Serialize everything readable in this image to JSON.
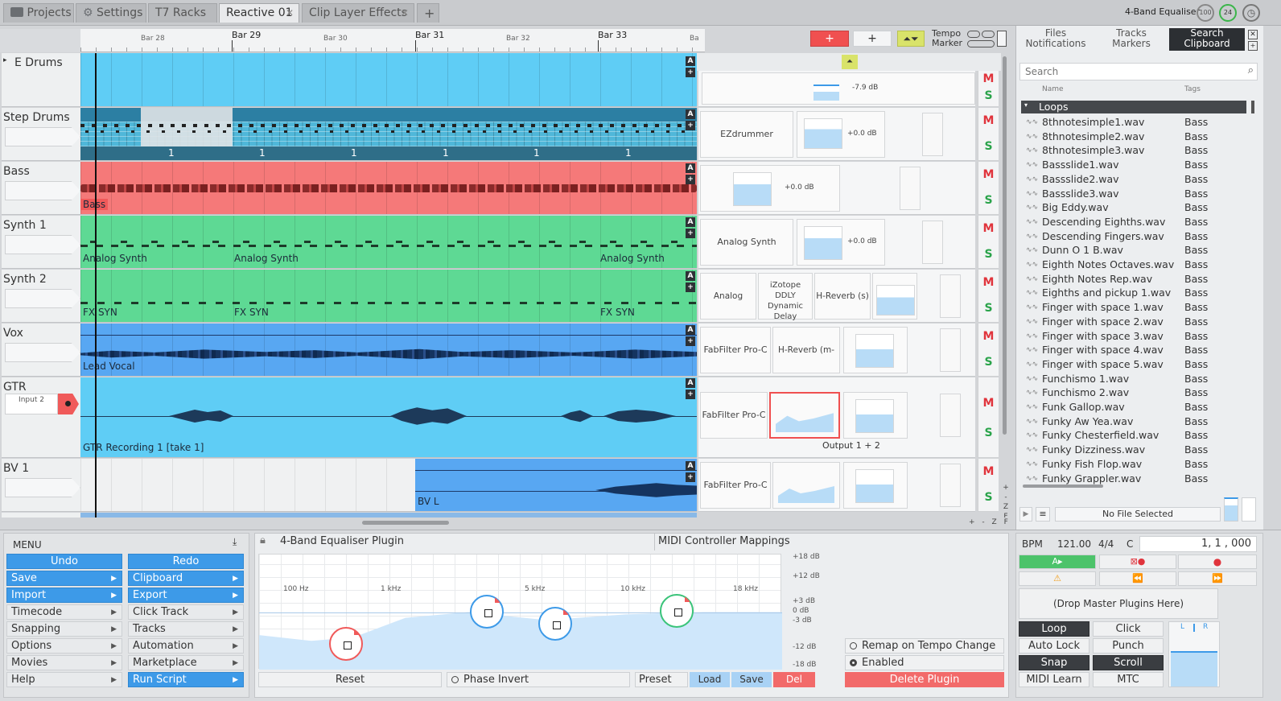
{
  "tabs": [
    {
      "label": "Projects",
      "icon": "folder-icon"
    },
    {
      "label": "Settings",
      "icon": "gear-icon"
    },
    {
      "label": "T7 Racks"
    },
    {
      "label": "Reactive 01",
      "active": true
    },
    {
      "label": "Clip Layer Effects"
    }
  ],
  "header": {
    "plugin_title": "4-Band Equaliser",
    "cpu": "100",
    "gauge": "24"
  },
  "ruler": {
    "bars": [
      "Bar 28",
      "Bar 29",
      "Bar 30",
      "Bar 31",
      "Bar 32",
      "Bar 33",
      "Ba"
    ]
  },
  "transport_top": {
    "tempo": "Tempo",
    "marker": "Marker",
    "add_plus": "+"
  },
  "tracks": [
    {
      "name": "E Drums",
      "db": "-7.9 dB"
    },
    {
      "name": "Step Drums",
      "plugin": "EZdrummer",
      "db": "+0.0 dB",
      "steps": [
        "1",
        "1",
        "1",
        "1",
        "1",
        "1"
      ]
    },
    {
      "name": "Bass",
      "clip": "Bass",
      "db": "+0.0 dB"
    },
    {
      "name": "Synth 1",
      "clip": "Analog Synth",
      "plugin": "Analog Synth",
      "db": "+0.0 dB"
    },
    {
      "name": "Synth 2",
      "clip": "FX SYN",
      "plugins": [
        "Analog Synth",
        "iZotope DDLY Dynamic Delay",
        "H-Reverb (s)"
      ]
    },
    {
      "name": "Vox",
      "clip": "Lead Vocal",
      "plugins": [
        "FabFilter Pro-C",
        "H-Reverb (m->s)"
      ]
    },
    {
      "name": "GTR",
      "input": "Input 2",
      "clip": "GTR Recording 1 [take 1]",
      "plugin": "FabFilter Pro-C",
      "output": "Output 1 + 2"
    },
    {
      "name": "BV 1",
      "clip": "BV L",
      "plugin": "FabFilter Pro-C"
    }
  ],
  "labels": {
    "m": "M",
    "s": "S",
    "a": "A",
    "plus": "+"
  },
  "browser": {
    "tabs": [
      {
        "top": "Files",
        "bottom": "Notifications"
      },
      {
        "top": "Tracks",
        "bottom": "Markers"
      },
      {
        "top": "Search",
        "bottom": "Clipboard",
        "active": true
      }
    ],
    "search_placeholder": "Search",
    "col_name": "Name",
    "col_tags": "Tags",
    "folder": "Loops",
    "files": [
      "8thnotesimple1.wav",
      "8thnotesimple2.wav",
      "8thnotesimple3.wav",
      "Bassslide1.wav",
      "Bassslide2.wav",
      "Bassslide3.wav",
      "Big Eddy.wav",
      "Descending Eighths.wav",
      "Descending Fingers.wav",
      "Dunn O 1 B.wav",
      "Eighth Notes Octaves.wav",
      "Eighth Notes Rep.wav",
      "Eighths and pickup 1.wav",
      "Finger with space 1.wav",
      "Finger with space 2.wav",
      "Finger with space 3.wav",
      "Finger with space 4.wav",
      "Finger with space 5.wav",
      "Funchismo 1.wav",
      "Funchismo 2.wav",
      "Funk Gallop.wav",
      "Funky Aw Yea.wav",
      "Funky Chesterfield.wav",
      "Funky Dizziness.wav",
      "Funky Fish Flop.wav",
      "Funky Grappler.wav"
    ],
    "tag": "Bass",
    "no_file": "No File Selected"
  },
  "menu": {
    "title": "MENU",
    "undo": "Undo",
    "redo": "Redo",
    "left": [
      "Save",
      "Import",
      "Timecode",
      "Snapping",
      "Options",
      "Movies",
      "Help"
    ],
    "right": [
      "Clipboard",
      "Export",
      "Click Track",
      "Tracks",
      "Automation",
      "Marketplace",
      "Run Script"
    ]
  },
  "eq": {
    "title": "4-Band Equaliser Plugin",
    "midi": "MIDI Controller Mappings",
    "freqs": [
      "100 Hz",
      "1 kHz",
      "5 kHz",
      "10 kHz",
      "18 kHz"
    ],
    "db": [
      "+18 dB",
      "+12 dB",
      "+3 dB",
      "0 dB",
      "-3 dB",
      "-12 dB",
      "-18 dB"
    ],
    "reset": "Reset",
    "phase": "Phase Invert",
    "preset": "Preset",
    "load": "Load",
    "save": "Save",
    "del": "Del",
    "remap": "Remap on Tempo Change",
    "enabled": "Enabled",
    "delete": "Delete Plugin"
  },
  "transport": {
    "bpm_label": "BPM",
    "bpm": "121.00",
    "sig": "4/4",
    "key": "C",
    "position": "1,  1 , 000",
    "drop": "(Drop Master Plugins Here)",
    "loop": "Loop",
    "click": "Click",
    "autolock": "Auto Lock",
    "punch": "Punch",
    "snap": "Snap",
    "scroll": "Scroll",
    "midilearn": "MIDI Learn",
    "mtc": "MTC",
    "l": "L",
    "r": "R"
  },
  "edge": {
    "plus": "+",
    "minus": "-",
    "z": "Z",
    "f": "F"
  }
}
